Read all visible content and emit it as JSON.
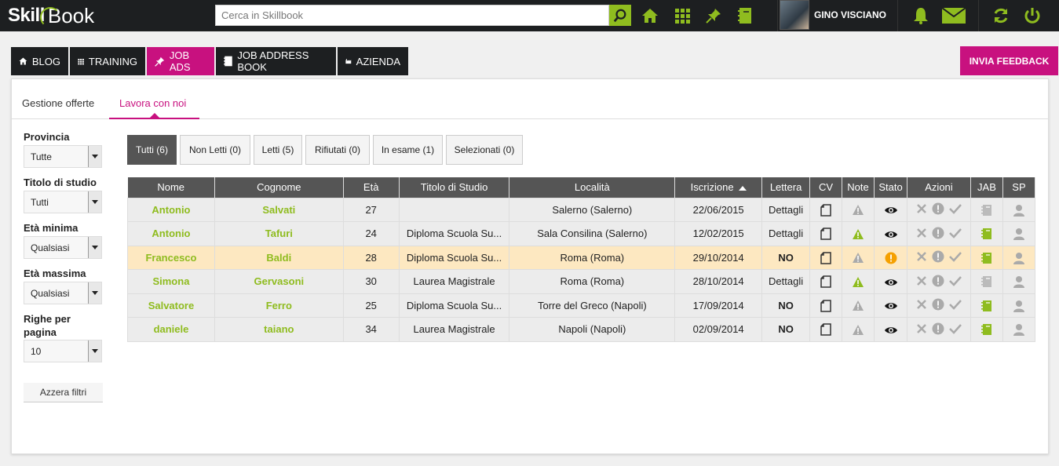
{
  "header": {
    "logo_part1": "Skill",
    "logo_part2": "Book",
    "search_placeholder": "Cerca in Skillbook",
    "user_name": "GINO VISCIANO"
  },
  "nav": {
    "tabs": [
      {
        "label": "BLOG",
        "icon": "home-icon"
      },
      {
        "label": "TRAINING",
        "icon": "grid-icon"
      },
      {
        "label": "JOB ADS",
        "icon": "pin-icon"
      },
      {
        "label": "JOB ADDRESS BOOK",
        "icon": "address-book-icon"
      },
      {
        "label": "AZIENDA",
        "icon": "factory-icon"
      }
    ],
    "active": "JOB ADS",
    "feedback_label": "INVIA FEEDBACK"
  },
  "subtabs": {
    "items": [
      "Gestione offerte",
      "Lavora con noi"
    ],
    "active": "Lavora con noi"
  },
  "filters": {
    "provincia_label": "Provincia",
    "provincia_value": "Tutte",
    "titolo_label": "Titolo di studio",
    "titolo_value": "Tutti",
    "eta_min_label": "Età minima",
    "eta_min_value": "Qualsiasi",
    "eta_max_label": "Età massima",
    "eta_max_value": "Qualsiasi",
    "righe_label_1": "Righe per",
    "righe_label_2": "pagina",
    "righe_value": "10",
    "reset_label": "Azzera filtri"
  },
  "status_filters": [
    "Tutti (6)",
    "Non Letti (0)",
    "Letti (5)",
    "Rifiutati (0)",
    "In esame (1)",
    "Selezionati (0)"
  ],
  "table": {
    "columns": [
      "Nome",
      "Cognome",
      "Età",
      "Titolo di Studio",
      "Località",
      "Iscrizione",
      "Lettera",
      "CV",
      "Note",
      "Stato",
      "Azioni",
      "JAB",
      "SP"
    ],
    "rows": [
      {
        "nome": "Antonio",
        "cognome": "Salvati",
        "eta": "27",
        "titolo": "",
        "localita": "Salerno (Salerno)",
        "iscrizione": "22/06/2015",
        "lettera": "Dettagli",
        "note": "gray",
        "stato": "eye",
        "jab": "gray"
      },
      {
        "nome": "Antonio",
        "cognome": "Tafuri",
        "eta": "24",
        "titolo": "Diploma Scuola Su...",
        "localita": "Sala Consilina (Salerno)",
        "iscrizione": "12/02/2015",
        "lettera": "Dettagli",
        "note": "green",
        "stato": "eye",
        "jab": "green"
      },
      {
        "nome": "Francesco",
        "cognome": "Baldi",
        "eta": "28",
        "titolo": "Diploma Scuola Su...",
        "localita": "Roma (Roma)",
        "iscrizione": "29/10/2014",
        "lettera": "NO",
        "note": "gray",
        "stato": "orange",
        "jab": "green"
      },
      {
        "nome": "Simona",
        "cognome": "Gervasoni",
        "eta": "30",
        "titolo": "Laurea Magistrale",
        "localita": "Roma (Roma)",
        "iscrizione": "28/10/2014",
        "lettera": "Dettagli",
        "note": "green",
        "stato": "eye",
        "jab": "gray"
      },
      {
        "nome": "Salvatore",
        "cognome": "Ferro",
        "eta": "25",
        "titolo": "Diploma Scuola Su...",
        "localita": "Torre del Greco (Napoli)",
        "iscrizione": "17/09/2014",
        "lettera": "NO",
        "note": "gray",
        "stato": "eye",
        "jab": "green"
      },
      {
        "nome": "daniele",
        "cognome": "taiano",
        "eta": "34",
        "titolo": "Laurea Magistrale",
        "localita": "Napoli (Napoli)",
        "iscrizione": "02/09/2014",
        "lettera": "NO",
        "note": "gray",
        "stato": "eye",
        "jab": "green"
      }
    ]
  },
  "colors": {
    "accent": "#c8117f",
    "green": "#8fbc1f",
    "dark": "#1d1f21",
    "highlight_row": "#fde8c1",
    "orange": "#f5a000"
  }
}
